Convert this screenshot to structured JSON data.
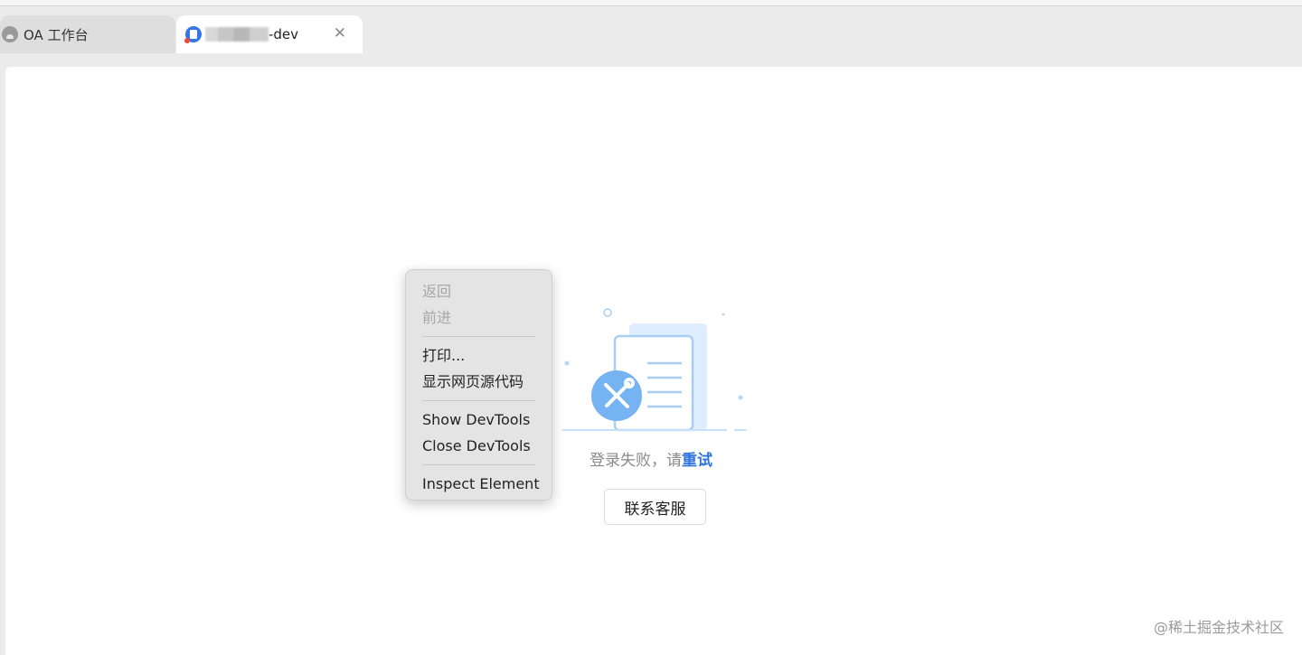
{
  "tabs": [
    {
      "label": "OA 工作台",
      "icon": "app-icon",
      "active": false
    },
    {
      "label": "-dev",
      "icon": "app-icon",
      "active": true
    }
  ],
  "tab_close_glyph": "✕",
  "content": {
    "message_text": "登录失败，请",
    "retry_label": "重试",
    "contact_button_label": "联系客服"
  },
  "context_menu": {
    "items": [
      {
        "label": "返回",
        "enabled": false
      },
      {
        "label": "前进",
        "enabled": false
      },
      {
        "label": "打印...",
        "enabled": true
      },
      {
        "label": "显示网页源代码",
        "enabled": true
      },
      {
        "label": "Show DevTools",
        "enabled": true
      },
      {
        "label": "Close DevTools",
        "enabled": true
      },
      {
        "label": "Inspect Element",
        "enabled": true
      }
    ]
  },
  "watermark": "@稀土掘金技术社区",
  "colors": {
    "accent": "#2f73e0",
    "tab_bar": "#ebebeb",
    "menu_bg": "#e4e4e4",
    "illustration_light": "#dfeeff",
    "illustration_stroke": "#a9cdf5",
    "illustration_circle": "#76b3f2"
  }
}
